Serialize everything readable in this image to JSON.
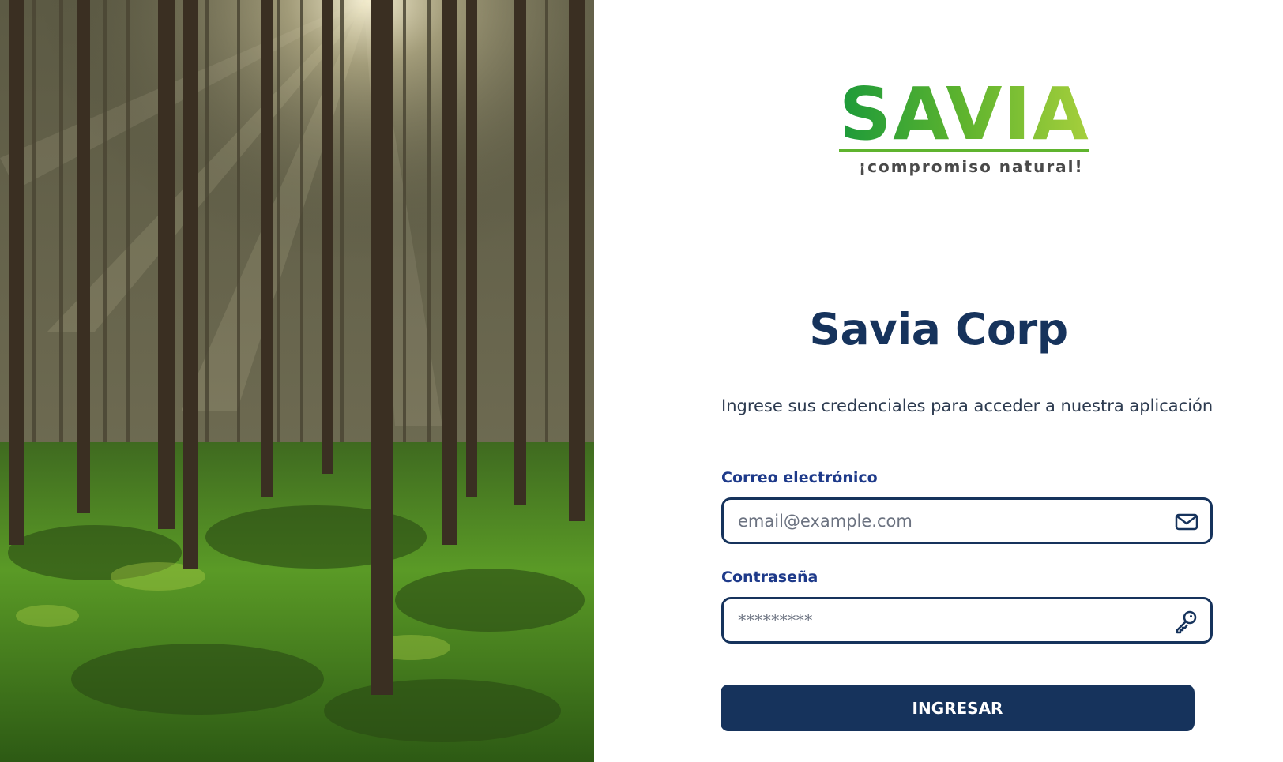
{
  "brand": {
    "logo_word": "SAVIA",
    "logo_tagline": "¡compromiso natural!",
    "green_light": "#9cc93a",
    "green_dark": "#1c9a3a"
  },
  "hero": {
    "image_description": "forest-photo",
    "sun_color": "#f3ecd0"
  },
  "login": {
    "title": "Savia Corp",
    "subtitle": "Ingrese sus credenciales para acceder a nuestra aplicación",
    "email_label": "Correo electrónico",
    "email_placeholder": "email@example.com",
    "email_icon": "envelope-icon",
    "password_label": "Contraseña",
    "password_placeholder": "*********",
    "password_icon": "key-icon",
    "submit_label": "INGRESAR",
    "accent": "#16335c"
  }
}
